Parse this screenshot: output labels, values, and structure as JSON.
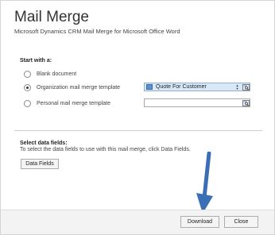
{
  "dialog": {
    "title": "Mail Merge",
    "subtitle": "Microsoft Dynamics CRM Mail Merge for Microsoft Office Word"
  },
  "start_with": {
    "heading": "Start with a:",
    "options": [
      {
        "label": "Blank document",
        "checked": false
      },
      {
        "label": "Organization mail merge template",
        "checked": true
      },
      {
        "label": "Personal mail merge template",
        "checked": false
      }
    ],
    "organization_template_value": "Quote For Customer",
    "personal_template_value": ""
  },
  "data_fields": {
    "heading": "Select data fields:",
    "description": "To select the data fields to use with this mail merge, click Data Fields.",
    "button_label": "Data Fields"
  },
  "footer": {
    "download_label": "Download",
    "close_label": "Close"
  },
  "colors": {
    "arrow": "#3b6fb5",
    "selected_lookup_bg": "#d9e8f7"
  }
}
